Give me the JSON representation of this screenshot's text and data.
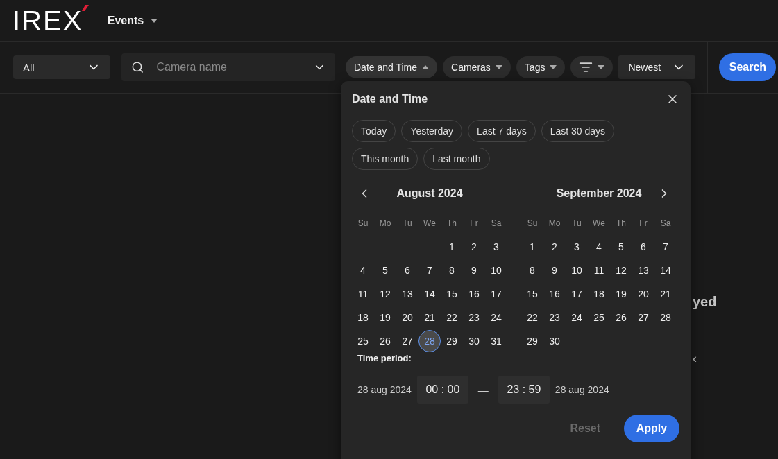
{
  "header": {
    "logo": "IREX",
    "section": "Events"
  },
  "toolbar": {
    "scope": "All",
    "camera_search": {
      "placeholder": "Camera name"
    },
    "filters": [
      {
        "kind": "text",
        "label": "Date and Time",
        "expanded": true
      },
      {
        "kind": "text",
        "label": "Cameras",
        "expanded": false
      },
      {
        "kind": "text",
        "label": "Tags",
        "expanded": false
      },
      {
        "kind": "icon",
        "expanded": false
      }
    ],
    "sort": "Newest",
    "search_button": "Search"
  },
  "background": {
    "heading_fragment": "yed",
    "text_fragment": "‹"
  },
  "date_popup": {
    "title": "Date and Time",
    "presets": [
      "Today",
      "Yesterday",
      "Last 7 days",
      "Last 30 days",
      "This month",
      "Last month"
    ],
    "months": [
      {
        "title": "August 2024",
        "weekdays": [
          "Su",
          "Mo",
          "Tu",
          "We",
          "Th",
          "Fr",
          "Sa"
        ],
        "weeks": [
          {
            "kind": "lead",
            "days": [
              {
                "day": "1",
                "selected": false
              },
              {
                "day": "2",
                "selected": false
              },
              {
                "day": "3",
                "selected": false
              }
            ]
          },
          {
            "kind": "full",
            "days": [
              {
                "day": "4",
                "selected": false
              },
              {
                "day": "5",
                "selected": false
              },
              {
                "day": "6",
                "selected": false
              },
              {
                "day": "7",
                "selected": false
              },
              {
                "day": "8",
                "selected": false
              },
              {
                "day": "9",
                "selected": false
              },
              {
                "day": "10",
                "selected": false
              }
            ]
          },
          {
            "kind": "full",
            "days": [
              {
                "day": "11",
                "selected": false
              },
              {
                "day": "12",
                "selected": false
              },
              {
                "day": "13",
                "selected": false
              },
              {
                "day": "14",
                "selected": false
              },
              {
                "day": "15",
                "selected": false
              },
              {
                "day": "16",
                "selected": false
              },
              {
                "day": "17",
                "selected": false
              }
            ]
          },
          {
            "kind": "full",
            "days": [
              {
                "day": "18",
                "selected": false
              },
              {
                "day": "19",
                "selected": false
              },
              {
                "day": "20",
                "selected": false
              },
              {
                "day": "21",
                "selected": false
              },
              {
                "day": "22",
                "selected": false
              },
              {
                "day": "23",
                "selected": false
              },
              {
                "day": "24",
                "selected": false
              }
            ]
          },
          {
            "kind": "full",
            "days": [
              {
                "day": "25",
                "selected": false
              },
              {
                "day": "26",
                "selected": false
              },
              {
                "day": "27",
                "selected": false
              },
              {
                "day": "28",
                "selected": true
              },
              {
                "day": "29",
                "selected": false
              },
              {
                "day": "30",
                "selected": false
              },
              {
                "day": "31",
                "selected": false
              }
            ]
          }
        ]
      },
      {
        "title": "September 2024",
        "weekdays": [
          "Su",
          "Mo",
          "Tu",
          "We",
          "Th",
          "Fr",
          "Sa"
        ],
        "weeks": [
          {
            "kind": "full",
            "days": [
              {
                "day": "1",
                "selected": false
              },
              {
                "day": "2",
                "selected": false
              },
              {
                "day": "3",
                "selected": false
              },
              {
                "day": "4",
                "selected": false
              },
              {
                "day": "5",
                "selected": false
              },
              {
                "day": "6",
                "selected": false
              },
              {
                "day": "7",
                "selected": false
              }
            ]
          },
          {
            "kind": "full",
            "days": [
              {
                "day": "8",
                "selected": false
              },
              {
                "day": "9",
                "selected": false
              },
              {
                "day": "10",
                "selected": false
              },
              {
                "day": "11",
                "selected": false
              },
              {
                "day": "12",
                "selected": false
              },
              {
                "day": "13",
                "selected": false
              },
              {
                "day": "14",
                "selected": false
              }
            ]
          },
          {
            "kind": "full",
            "days": [
              {
                "day": "15",
                "selected": false
              },
              {
                "day": "16",
                "selected": false
              },
              {
                "day": "17",
                "selected": false
              },
              {
                "day": "18",
                "selected": false
              },
              {
                "day": "19",
                "selected": false
              },
              {
                "day": "20",
                "selected": false
              },
              {
                "day": "21",
                "selected": false
              }
            ]
          },
          {
            "kind": "full",
            "days": [
              {
                "day": "22",
                "selected": false
              },
              {
                "day": "23",
                "selected": false
              },
              {
                "day": "24",
                "selected": false
              },
              {
                "day": "25",
                "selected": false
              },
              {
                "day": "26",
                "selected": false
              },
              {
                "day": "27",
                "selected": false
              },
              {
                "day": "28",
                "selected": false
              }
            ]
          },
          {
            "kind": "trail",
            "days": [
              {
                "day": "29",
                "selected": false
              },
              {
                "day": "30",
                "selected": false
              }
            ]
          }
        ]
      }
    ],
    "time_period": {
      "label": "Time period:",
      "start_date": "28 aug 2024",
      "start_time": "00 : 00",
      "separator": "—",
      "end_time": "23 : 59",
      "end_date": "28 aug 2024"
    },
    "reset_button": {
      "label": "Reset",
      "disabled": true
    },
    "apply_button": "Apply"
  }
}
